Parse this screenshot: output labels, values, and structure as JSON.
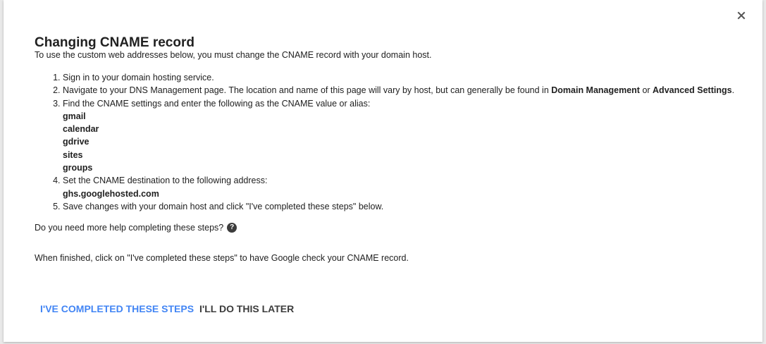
{
  "dialog": {
    "title": "Changing CNAME record",
    "intro": "To use the custom web addresses below, you must change the CNAME record with your domain host.",
    "steps": {
      "step1": "Sign in to your domain hosting service.",
      "step2_prefix": "Navigate to your DNS Management page. The location and name of this page will vary by host, but can generally be found in ",
      "step2_bold1": "Domain Management",
      "step2_mid": " or ",
      "step2_bold2": "Advanced Settings",
      "step2_suffix": ".",
      "step3": "Find the CNAME settings and enter the following as the CNAME value or alias:",
      "aliases": [
        "gmail",
        "calendar",
        "gdrive",
        "sites",
        "groups"
      ],
      "step4": "Set the CNAME destination to the following address:",
      "destination": "ghs.googlehosted.com",
      "step5": "Save changes with your domain host and click \"I've completed these steps\" below."
    },
    "help_text": "Do you need more help completing these steps?",
    "help_icon": "?",
    "finish_text": "When finished, click on \"I've completed these steps\" to have Google check your CNAME record.",
    "buttons": {
      "completed": "I'VE COMPLETED THESE STEPS",
      "later": "I'LL DO THIS LATER"
    },
    "close_icon": "close-icon"
  },
  "colors": {
    "primary_button": "#4285f4",
    "secondary_button": "#3c3c3c",
    "text": "#212121"
  }
}
